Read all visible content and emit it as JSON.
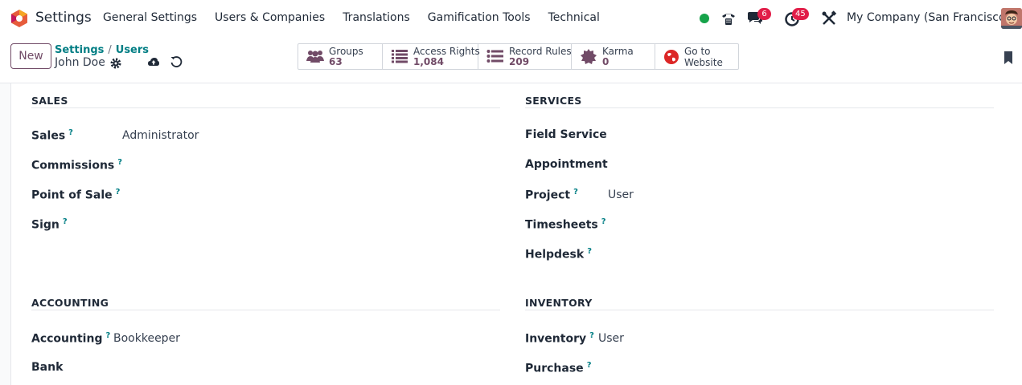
{
  "app": {
    "name": "Settings"
  },
  "menu": [
    {
      "key": "general",
      "label": "General Settings"
    },
    {
      "key": "users",
      "label": "Users & Companies"
    },
    {
      "key": "translations",
      "label": "Translations"
    },
    {
      "key": "gamification",
      "label": "Gamification Tools"
    },
    {
      "key": "technical",
      "label": "Technical"
    }
  ],
  "systray": {
    "messages_count": "6",
    "activities_count": "45",
    "company": "My Company (San Francisco)",
    "status_color": "#16a34a"
  },
  "control": {
    "new_label": "New",
    "breadcrumb": [
      "Settings",
      "Users"
    ],
    "record_name": "John Doe"
  },
  "smart_buttons": [
    {
      "key": "groups",
      "label": "Groups",
      "value": "63",
      "icon": "users-icon"
    },
    {
      "key": "access-rights",
      "label": "Access Rights",
      "value": "1,084",
      "icon": "list-icon"
    },
    {
      "key": "record-rules",
      "label": "Record Rules",
      "value": "209",
      "icon": "list-bullets-icon"
    },
    {
      "key": "karma",
      "label": "Karma",
      "value": "0",
      "icon": "badge-icon"
    },
    {
      "key": "website",
      "label": "Go to",
      "value": "Website",
      "icon": "globe-icon"
    }
  ],
  "sections": {
    "sales": {
      "title": "SALES",
      "fields": [
        {
          "label": "Sales",
          "help": "?",
          "value": "Administrator"
        },
        {
          "label": "Commissions",
          "help": "?",
          "value": ""
        },
        {
          "label": "Point of Sale",
          "help": "?",
          "value": ""
        },
        {
          "label": "Sign",
          "help": "?",
          "value": ""
        }
      ]
    },
    "services": {
      "title": "SERVICES",
      "fields": [
        {
          "label": "Field Service",
          "help": "",
          "value": ""
        },
        {
          "label": "Appointment",
          "help": "",
          "value": ""
        },
        {
          "label": "Project",
          "help": "?",
          "value": "User"
        },
        {
          "label": "Timesheets",
          "help": "?",
          "value": ""
        },
        {
          "label": "Helpdesk",
          "help": "?",
          "value": ""
        }
      ]
    },
    "accounting": {
      "title": "ACCOUNTING",
      "fields": [
        {
          "label": "Accounting",
          "help": "?",
          "value": "Bookkeeper"
        },
        {
          "label": "Bank",
          "help": "",
          "value": ""
        }
      ]
    },
    "inventory": {
      "title": "INVENTORY",
      "fields": [
        {
          "label": "Inventory",
          "help": "?",
          "value": "User"
        },
        {
          "label": "Purchase",
          "help": "?",
          "value": ""
        }
      ]
    }
  },
  "colors": {
    "brand": "#714b67",
    "link": "#017e84",
    "badge": "#e11d48"
  }
}
